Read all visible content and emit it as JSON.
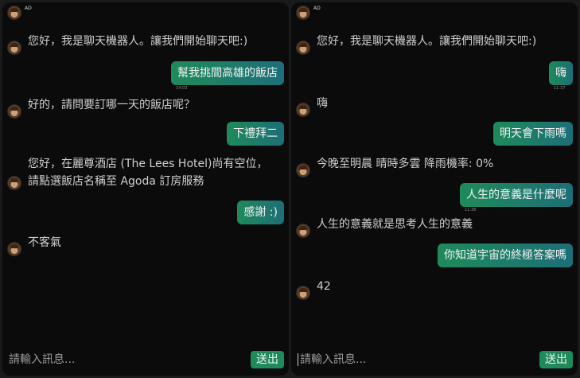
{
  "left": {
    "header_label": "AD",
    "messages": [
      {
        "role": "bot",
        "text": "您好，我是聊天機器人。讓我們開始聊天吧:)"
      },
      {
        "role": "user",
        "text": "幫我挑間高雄的飯店",
        "time": "14:03"
      },
      {
        "role": "bot",
        "text": "好的，請問要訂哪一天的飯店呢？"
      },
      {
        "role": "user",
        "text": "下禮拜二"
      },
      {
        "role": "bot",
        "text": "您好，在麗尊酒店 (The Lees Hotel)尚有空位，\n請點選飯店名稱至 Agoda 訂房服務"
      },
      {
        "role": "user",
        "text": "感謝 :)"
      },
      {
        "role": "bot",
        "text": "不客氣"
      }
    ],
    "input_placeholder": "請輸入訊息...",
    "send_label": "送出"
  },
  "right": {
    "header_label": "AD",
    "messages": [
      {
        "role": "bot",
        "text": "您好，我是聊天機器人。讓我們開始聊天吧:)"
      },
      {
        "role": "user",
        "text": "嗨",
        "time": "11:37"
      },
      {
        "role": "bot",
        "text": "嗨"
      },
      {
        "role": "user",
        "text": "明天會下雨嗎"
      },
      {
        "role": "bot",
        "text": "今晚至明晨 晴時多雲 降雨機率: 0%"
      },
      {
        "role": "user",
        "text": "人生的意義是什麼呢",
        "time": "11:38"
      },
      {
        "role": "bot",
        "text": "人生的意義就是思考人生的意義"
      },
      {
        "role": "user",
        "text": "你知道宇宙的終極答案嗎"
      },
      {
        "role": "bot",
        "text": "42"
      }
    ],
    "input_placeholder": "請輸入訊息...",
    "send_label": "送出"
  }
}
